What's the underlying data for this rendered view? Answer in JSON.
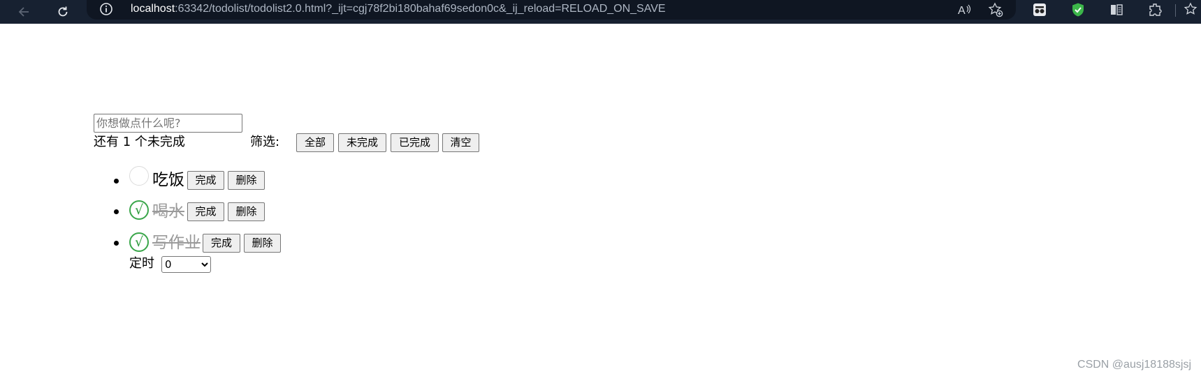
{
  "browser": {
    "url_host": "localhost",
    "url_rest": ":63342/todolist/todolist2.0.html?_ijt=cgj78f2bi180bahaf69sedon0c&_ij_reload=RELOAD_ON_SAVE",
    "icons": [
      "back-icon",
      "refresh-icon",
      "info-icon",
      "read-aloud-icon",
      "add-favorite-icon",
      "extension-glasses-icon",
      "shield-check-icon",
      "reader-icon",
      "extensions-icon",
      "favorites-icon"
    ]
  },
  "todo": {
    "input_placeholder": "你想做点什么呢?",
    "input_value": "",
    "remaining_text": "还有 1 个未完成",
    "filter_label": "筛选:",
    "filter_buttons": [
      "全部",
      "未完成",
      "已完成",
      "清空"
    ],
    "items": [
      {
        "text": "吃饭",
        "done": false,
        "check": "",
        "complete_label": "完成",
        "delete_label": "删除"
      },
      {
        "text": "喝水",
        "done": true,
        "check": "√",
        "complete_label": "完成",
        "delete_label": "删除"
      },
      {
        "text": "写作业",
        "done": true,
        "check": "√",
        "complete_label": "完成",
        "delete_label": "删除"
      }
    ],
    "timer_label": "定时",
    "timer_value": "0"
  },
  "watermark": "CSDN @ausj18188sjsj",
  "colors": {
    "browser_bar": "#172131",
    "check_green": "#2b9a3a",
    "done_text": "#9a9a9a"
  }
}
